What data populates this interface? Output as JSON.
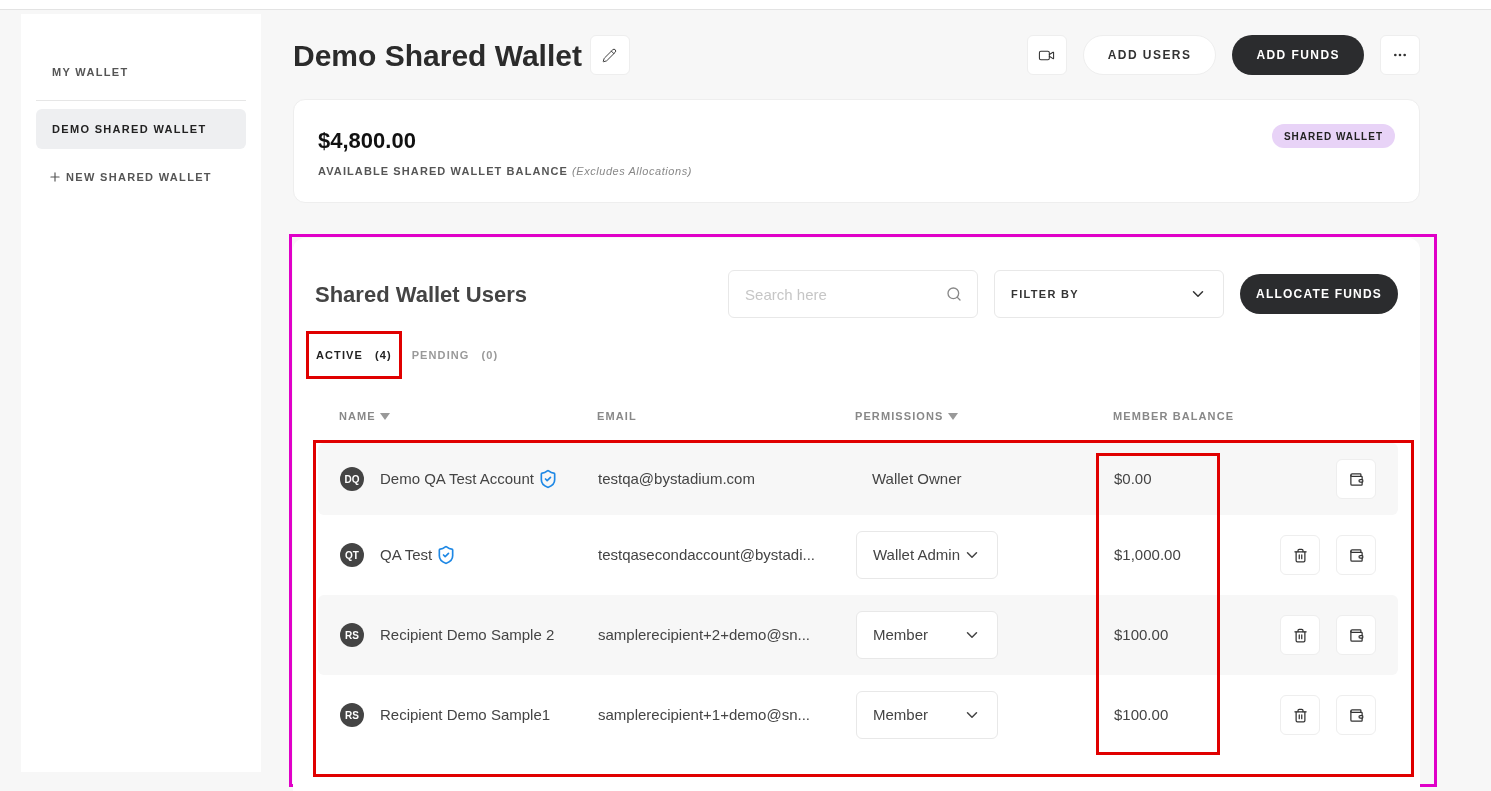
{
  "sidebar": {
    "items": [
      {
        "label": "MY WALLET",
        "selected": false,
        "kind": "link"
      },
      {
        "label": "DEMO SHARED WALLET",
        "selected": true,
        "kind": "link"
      },
      {
        "label": "NEW SHARED WALLET",
        "selected": false,
        "kind": "add"
      }
    ]
  },
  "header": {
    "title": "Demo Shared Wallet",
    "buttons": [
      {
        "kind": "video"
      },
      {
        "kind": "outline",
        "label": "ADD USERS"
      },
      {
        "kind": "primary",
        "label": "ADD FUNDS"
      },
      {
        "kind": "more"
      }
    ]
  },
  "balance_card": {
    "amount": "$4,800.00",
    "label": "AVAILABLE SHARED WALLET BALANCE",
    "note": "(Excludes Allocations)",
    "badge": "SHARED WALLET"
  },
  "users": {
    "title": "Shared Wallet Users",
    "search": {
      "placeholder": "Search here"
    },
    "filter": {
      "label": "FILTER BY"
    },
    "allocate_button": "ALLOCATE FUNDS",
    "tabs": [
      {
        "label": "ACTIVE",
        "count": "(4)",
        "selected": true
      },
      {
        "label": "PENDING",
        "count": "(0)",
        "selected": false
      }
    ],
    "columns": [
      {
        "label": "NAME",
        "sortable": true
      },
      {
        "label": "EMAIL",
        "sortable": false
      },
      {
        "label": "PERMISSIONS",
        "sortable": true
      },
      {
        "label": "MEMBER BALANCE",
        "sortable": false
      }
    ],
    "rows": [
      {
        "initials": "DQ",
        "name": "Demo QA Test Account",
        "admin": true,
        "email": "testqa@bystadium.com",
        "permission": "Wallet Owner",
        "kind": "static",
        "balance": "$0.00",
        "deletable": false
      },
      {
        "initials": "QT",
        "name": "QA Test",
        "admin": true,
        "email": "testqasecondaccount@bystadi...",
        "permission": "Wallet Admin",
        "kind": "dropdown",
        "balance": "$1,000.00",
        "deletable": true
      },
      {
        "initials": "RS",
        "name": "Recipient Demo Sample 2",
        "admin": false,
        "email": "samplerecipient+2+demo@sn...",
        "permission": "Member",
        "kind": "dropdown",
        "balance": "$100.00",
        "deletable": true
      },
      {
        "initials": "RS",
        "name": "Recipient Demo Sample1",
        "admin": false,
        "email": "samplerecipient+1+demo@sn...",
        "permission": "Member",
        "kind": "dropdown",
        "balance": "$100.00",
        "deletable": true
      }
    ]
  },
  "annotations": [
    {
      "kind": "users_section",
      "color": "#e000c8"
    },
    {
      "kind": "active_tab",
      "color": "#e00000"
    },
    {
      "kind": "rows",
      "color": "#e00000"
    },
    {
      "kind": "balance_column",
      "color": "#e00000"
    }
  ]
}
